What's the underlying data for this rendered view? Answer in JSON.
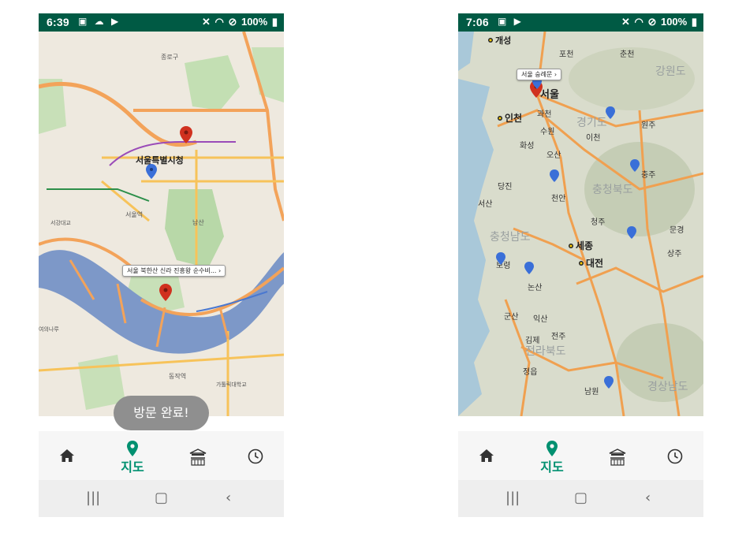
{
  "screens": [
    {
      "status": {
        "time": "6:39",
        "battery": "100%"
      },
      "map": {
        "place_label": "서울특별시청",
        "callout": "서울 북한산 신라 진흥왕 순수비...",
        "labels": [
          "용산역",
          "남산",
          "종로구",
          "서강대교",
          "노량진역",
          "동작역",
          "금화산",
          "반포대교"
        ]
      },
      "toast": "방문 완료!",
      "nav": {
        "active_label": "지도"
      }
    },
    {
      "status": {
        "time": "7:06",
        "battery": "100%"
      },
      "map": {
        "callout": "서울 숭례문",
        "cities": [
          "개성",
          "서울",
          "인천",
          "세종",
          "대전",
          "과천",
          "수원",
          "화성",
          "오산",
          "이천",
          "원주",
          "충주",
          "청주",
          "천안",
          "당진",
          "서산",
          "보령",
          "논산",
          "익산",
          "군산",
          "전주",
          "김제",
          "남원",
          "정읍",
          "상주",
          "문경",
          "포천",
          "춘천"
        ],
        "regions": [
          "충청북도",
          "충청남도",
          "전라북도",
          "경상남도",
          "강원도",
          "경기도"
        ]
      },
      "nav": {
        "active_label": "지도"
      }
    }
  ],
  "colors": {
    "statusbar": "#005a44",
    "accent": "#009070",
    "pin_red": "#d0311f",
    "pin_blue": "#3a6fd8"
  }
}
